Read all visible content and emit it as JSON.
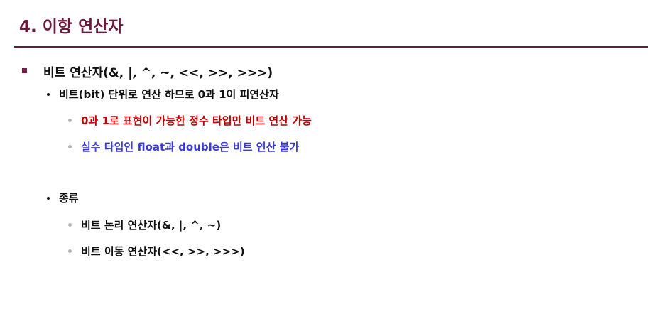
{
  "slide": {
    "title": "4. 이항 연산자",
    "colors": {
      "title": "#6b1a3c",
      "square_bullet": "#7a1c44",
      "highlight_red": "#c00000",
      "highlight_blue": "#3a3ad8"
    }
  },
  "content": {
    "main_bullet": "비트 연산자(&, |, ^, ~, <<, >>, >>>)",
    "sub1": {
      "text": "비트(bit) 단위로 연산 하므로 0과 1이 피연산자",
      "items": [
        "0과 1로 표현이 가능한 정수 타입만 비트 연산 가능",
        "실수 타입인 float과 double은 비트 연산 불가"
      ]
    },
    "sub2": {
      "text": "종류",
      "items": [
        "비트 논리 연산자(&, |, ^, ~)",
        "비트 이동 연산자(<<, >>, >>>)"
      ]
    }
  }
}
